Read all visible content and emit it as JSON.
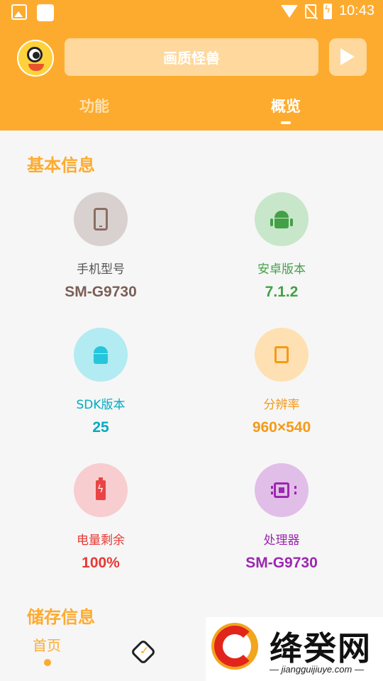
{
  "status_bar": {
    "time": "10:43"
  },
  "header": {
    "app_title": "画质怪兽",
    "tabs": [
      {
        "label": "功能",
        "active": false
      },
      {
        "label": "概览",
        "active": true
      }
    ]
  },
  "sections": {
    "basic_info_title": "基本信息",
    "storage_info_title": "储存信息"
  },
  "info_cards": [
    {
      "label": "手机型号",
      "value": "SM-G9730",
      "color": "#7b5e57",
      "bg": "#d9d1cf",
      "icon": "phone-icon"
    },
    {
      "label": "安卓版本",
      "value": "7.1.2",
      "color": "#43a047",
      "bg": "#c8e6c9",
      "icon": "android-icon"
    },
    {
      "label": "SDK版本",
      "value": "25",
      "color": "#00acc1",
      "bg": "#b2ebf2",
      "icon": "android-robot-icon"
    },
    {
      "label": "分辨率",
      "value": "960×540",
      "color": "#f59a17",
      "bg": "#ffe0b2",
      "icon": "tablet-icon"
    },
    {
      "label": "电量剩余",
      "value": "100%",
      "color": "#e53935",
      "bg": "#f8cdd0",
      "icon": "battery-icon"
    },
    {
      "label": "处理器",
      "value": "SM-G9730",
      "color": "#9c27b0",
      "bg": "#e1bee7",
      "icon": "cpu-icon"
    }
  ],
  "bottom_nav": {
    "home_label": "首页"
  },
  "watermark": {
    "brand": "绛癸网",
    "url": "— jiangguijiuye.com —"
  },
  "colors": {
    "accent": "#fdab2f"
  }
}
